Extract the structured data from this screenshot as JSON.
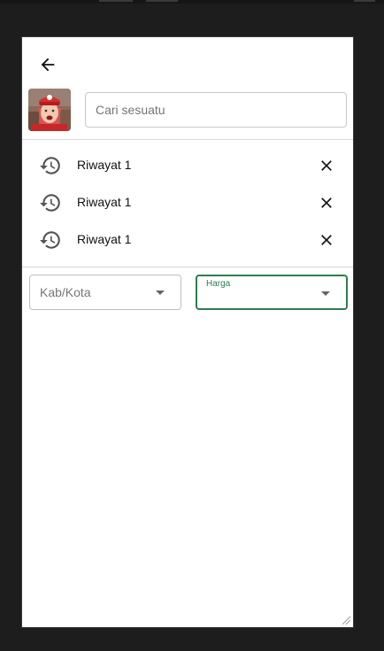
{
  "search": {
    "placeholder": "Cari sesuatu",
    "value": ""
  },
  "history": {
    "items": [
      {
        "label": "Riwayat 1"
      },
      {
        "label": "Riwayat 1"
      },
      {
        "label": "Riwayat 1"
      }
    ]
  },
  "filters": {
    "kab_kota": {
      "placeholder": "Kab/Kota"
    },
    "harga": {
      "label": "Harga",
      "value": ""
    }
  },
  "colors": {
    "accent": "#2e7d4f",
    "background": "#1d1d1d",
    "surface": "#ffffff"
  },
  "icons": {
    "back": "arrow-left-icon",
    "history": "history-icon",
    "close": "close-icon",
    "dropdown": "caret-down-icon"
  }
}
